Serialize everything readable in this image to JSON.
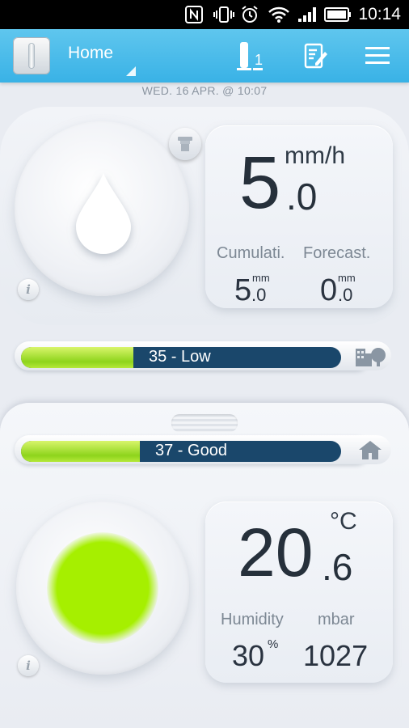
{
  "status_bar": {
    "time": "10:14",
    "icons": [
      "nfc-icon",
      "vibrate-icon",
      "alarm-icon",
      "wifi-icon",
      "signal-icon",
      "battery-icon"
    ]
  },
  "app_bar": {
    "title": "Home",
    "station_badge": "1"
  },
  "date_line": "WED. 16 APR. @ 10:07",
  "rain": {
    "value_int": "5",
    "value_dec": ".0",
    "unit": "mm/h",
    "cumulative_label": "Cumulati.",
    "cumulative_int": "5",
    "cumulative_dec": ".0",
    "cumulative_unit": "mm",
    "forecast_label": "Forecast.",
    "forecast_int": "0",
    "forecast_dec": ".0",
    "forecast_unit": "mm"
  },
  "outdoor_quality": {
    "text": "35 - Low",
    "level": 0.35
  },
  "indoor_quality": {
    "text": "37 - Good",
    "level": 0.37
  },
  "indoor": {
    "temp_int": "20",
    "temp_dec": ".6",
    "temp_unit": "°C",
    "humidity_label": "Humidity",
    "humidity_value": "30",
    "humidity_unit": "%",
    "pressure_label": "mbar",
    "pressure_value": "1027",
    "status_color": "#a6ef00"
  },
  "colors": {
    "accent": "#39b2e6",
    "bar_dark": "#1a476b",
    "bar_green": "#8ed41c"
  }
}
